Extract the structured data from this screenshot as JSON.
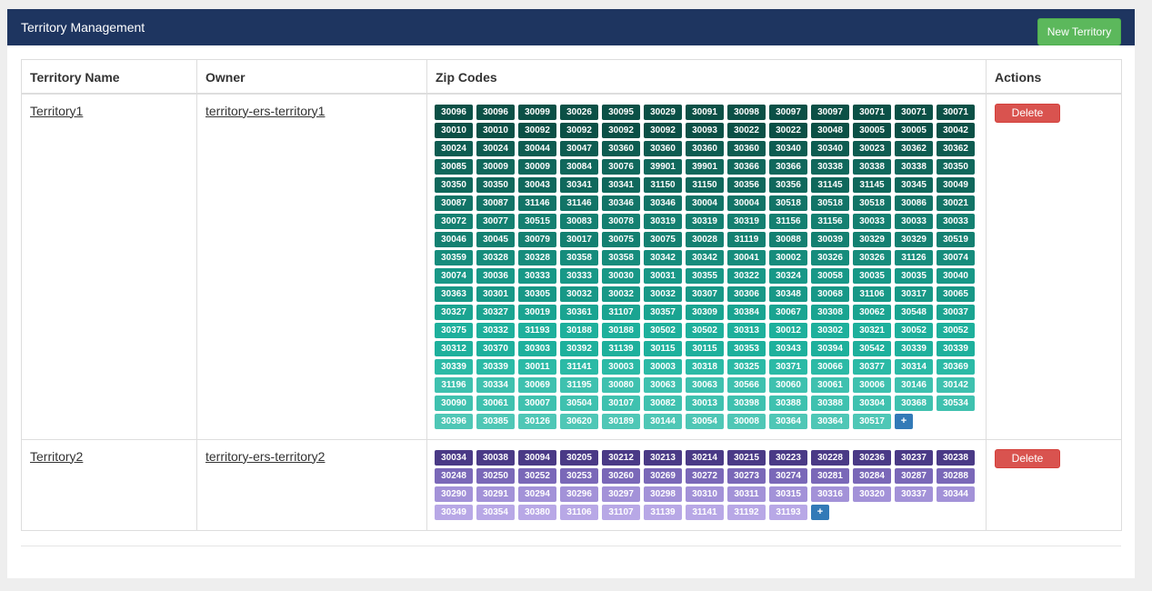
{
  "header": {
    "title": "Territory Management",
    "new_button": "New Territory"
  },
  "table": {
    "columns": [
      "Territory Name",
      "Owner",
      "Zip Codes",
      "Actions"
    ],
    "rows": [
      {
        "name": "Territory1",
        "owner": "territory-ers-territory1",
        "action": "Delete",
        "more_label": "+",
        "colors": [
          "#0b5046",
          "#0e5c51",
          "#10685c",
          "#127467",
          "#148071",
          "#168c7c",
          "#189887",
          "#1aa491",
          "#1eb09c",
          "#2bbaa6",
          "#3fc1af",
          "#4fc7b6"
        ],
        "zips": [
          "30096",
          "30096",
          "30099",
          "30026",
          "30095",
          "30029",
          "30091",
          "30098",
          "30097",
          "30097",
          "30071",
          "30071",
          "30071",
          "30010",
          "30010",
          "30092",
          "30092",
          "30092",
          "30092",
          "30093",
          "30022",
          "30022",
          "30048",
          "30005",
          "30005",
          "30042",
          "30024",
          "30024",
          "30044",
          "30047",
          "30360",
          "30360",
          "30360",
          "30360",
          "30340",
          "30340",
          "30023",
          "30362",
          "30362",
          "30085",
          "30009",
          "30009",
          "30084",
          "30076",
          "39901",
          "39901",
          "30366",
          "30366",
          "30338",
          "30338",
          "30338",
          "30350",
          "30350",
          "30350",
          "30043",
          "30341",
          "30341",
          "31150",
          "31150",
          "30356",
          "30356",
          "31145",
          "31145",
          "30345",
          "30049",
          "30087",
          "30087",
          "31146",
          "31146",
          "30346",
          "30346",
          "30004",
          "30004",
          "30518",
          "30518",
          "30518",
          "30086",
          "30021",
          "30072",
          "30077",
          "30515",
          "30083",
          "30078",
          "30319",
          "30319",
          "30319",
          "31156",
          "31156",
          "30033",
          "30033",
          "30033",
          "30046",
          "30045",
          "30079",
          "30017",
          "30075",
          "30075",
          "30028",
          "31119",
          "30088",
          "30039",
          "30329",
          "30329",
          "30519",
          "30359",
          "30328",
          "30328",
          "30358",
          "30358",
          "30342",
          "30342",
          "30041",
          "30002",
          "30326",
          "30326",
          "31126",
          "30074",
          "30074",
          "30036",
          "30333",
          "30333",
          "30030",
          "30031",
          "30355",
          "30322",
          "30324",
          "30058",
          "30035",
          "30035",
          "30040",
          "30363",
          "30301",
          "30305",
          "30032",
          "30032",
          "30032",
          "30307",
          "30306",
          "30348",
          "30068",
          "31106",
          "30317",
          "30065",
          "30327",
          "30327",
          "30019",
          "30361",
          "31107",
          "30357",
          "30309",
          "30384",
          "30067",
          "30308",
          "30062",
          "30548",
          "30037",
          "30375",
          "30332",
          "31193",
          "30188",
          "30188",
          "30502",
          "30502",
          "30313",
          "30012",
          "30302",
          "30321",
          "30052",
          "30052",
          "30312",
          "30370",
          "30303",
          "30392",
          "31139",
          "30115",
          "30115",
          "30353",
          "30343",
          "30394",
          "30542",
          "30339",
          "30339",
          "30339",
          "30339",
          "30011",
          "31141",
          "30003",
          "30003",
          "30318",
          "30325",
          "30371",
          "30066",
          "30377",
          "30314",
          "30369",
          "31196",
          "30334",
          "30069",
          "31195",
          "30080",
          "30063",
          "30063",
          "30566",
          "30060",
          "30061",
          "30006",
          "30146",
          "30142",
          "30090",
          "30061",
          "30007",
          "30504",
          "30107",
          "30082",
          "30013",
          "30398",
          "30388",
          "30388",
          "30304",
          "30368",
          "30534",
          "30396",
          "30385",
          "30126",
          "30620",
          "30189",
          "30144",
          "30054",
          "30008",
          "30364",
          "30364",
          "30517"
        ]
      },
      {
        "name": "Territory2",
        "owner": "territory-ers-territory2",
        "action": "Delete",
        "more_label": "+",
        "colors": [
          "#4a3a86",
          "#7a68b8",
          "#a392d8",
          "#b8a8e6"
        ],
        "zips": [
          "30034",
          "30038",
          "30094",
          "30205",
          "30212",
          "30213",
          "30214",
          "30215",
          "30223",
          "30228",
          "30236",
          "30237",
          "30238",
          "30248",
          "30250",
          "30252",
          "30253",
          "30260",
          "30269",
          "30272",
          "30273",
          "30274",
          "30281",
          "30284",
          "30287",
          "30288",
          "30290",
          "30291",
          "30294",
          "30296",
          "30297",
          "30298",
          "30310",
          "30311",
          "30315",
          "30316",
          "30320",
          "30337",
          "30344",
          "30349",
          "30354",
          "30380",
          "31106",
          "31107",
          "31139",
          "31141",
          "31192",
          "31193"
        ]
      }
    ]
  }
}
